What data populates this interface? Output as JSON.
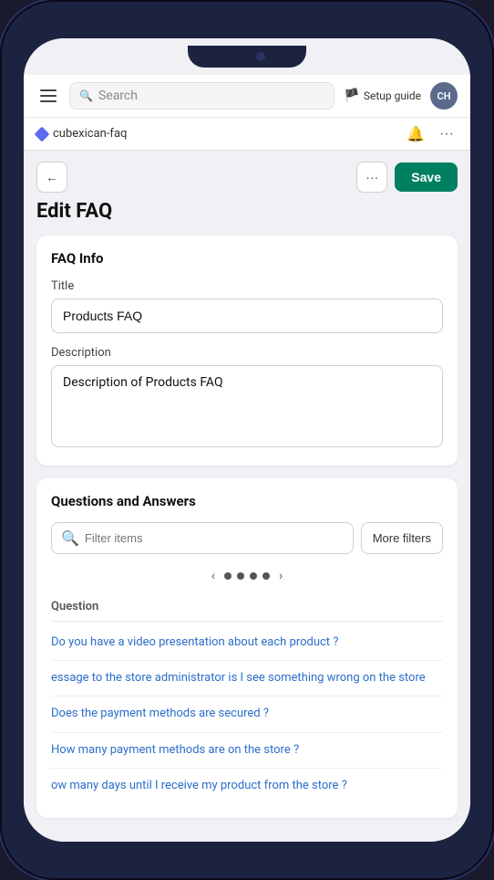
{
  "phone": {
    "notch": "notch"
  },
  "topNav": {
    "hamburger_label": "menu",
    "search_placeholder": "Search",
    "setup_guide_label": "Setup guide",
    "avatar_initials": "CH"
  },
  "tabBar": {
    "tab_name": "cubexican-faq",
    "bell_icon": "🔔",
    "more_icon": "···"
  },
  "toolbar": {
    "back_icon": "←",
    "more_icon": "···",
    "save_label": "Save"
  },
  "page": {
    "title": "Edit FAQ"
  },
  "faqInfo": {
    "card_title": "FAQ Info",
    "title_label": "Title",
    "title_value": "Products FAQ",
    "description_label": "Description",
    "description_value": "Description of Products FAQ"
  },
  "questionsAndAnswers": {
    "card_title": "Questions and Answers",
    "filter_placeholder": "Filter items",
    "more_filters_label": "More filters",
    "pagination": {
      "prev_icon": "‹",
      "dots": [
        "•",
        "•",
        "•",
        "•"
      ],
      "next_icon": "›"
    },
    "column_header": "Question",
    "questions": [
      "Do you have a video presentation about each product ?",
      "essage to the store administrator is I see something wrong on the store",
      "Does the payment methods are secured ?",
      "How many payment methods are on the store ?",
      "ow many days until I receive my product from the store ?"
    ]
  }
}
